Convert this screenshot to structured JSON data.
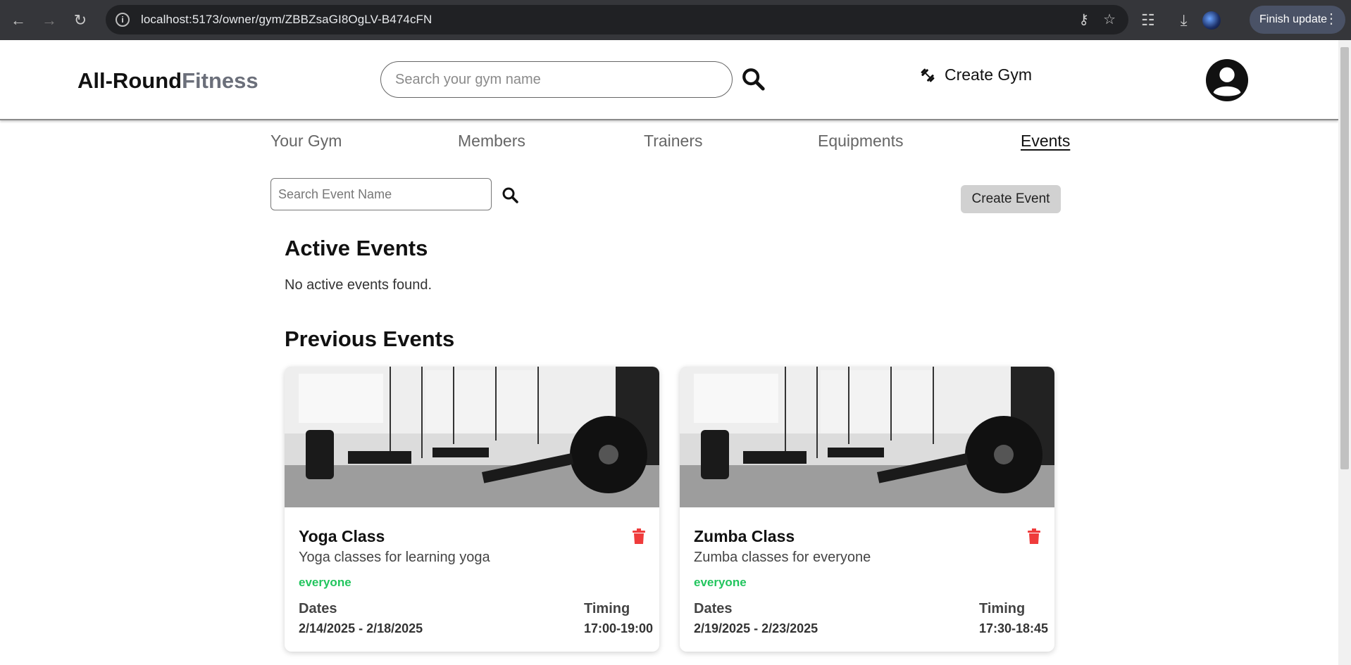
{
  "browser": {
    "url": "localhost:5173/owner/gym/ZBBZsaGI8OgLV-B474cFN",
    "finish_update": "Finish update"
  },
  "header": {
    "logo_part1": "All-Round",
    "logo_part2": "Fitness",
    "search_placeholder": "Search your gym name",
    "create_gym": "Create Gym"
  },
  "tabs": [
    {
      "label": "Your Gym",
      "active": false
    },
    {
      "label": "Members",
      "active": false
    },
    {
      "label": "Trainers",
      "active": false
    },
    {
      "label": "Equipments",
      "active": false
    },
    {
      "label": "Events",
      "active": true
    }
  ],
  "toolbar": {
    "event_search_placeholder": "Search Event Name",
    "create_event": "Create Event"
  },
  "active_events": {
    "heading": "Active Events",
    "empty_message": "No active events found."
  },
  "previous_events": {
    "heading": "Previous Events",
    "items": [
      {
        "title": "Yoga Class",
        "description": "Yoga classes for learning yoga",
        "audience": "everyone",
        "dates_label": "Dates",
        "dates": "2/14/2025 - 2/18/2025",
        "timing_label": "Timing",
        "timing": "17:00-19:00"
      },
      {
        "title": "Zumba Class",
        "description": "Zumba classes for everyone",
        "audience": "everyone",
        "dates_label": "Dates",
        "dates": "2/19/2025 - 2/23/2025",
        "timing_label": "Timing",
        "timing": "17:30-18:45"
      }
    ]
  },
  "colors": {
    "accent_green": "#22c55e",
    "delete_red": "#ef3b3b"
  }
}
